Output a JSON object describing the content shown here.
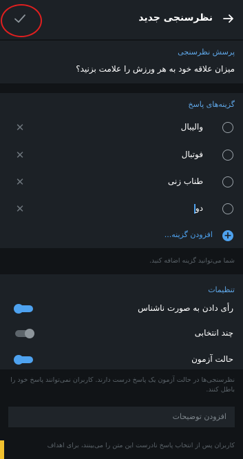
{
  "header": {
    "title": "نظرسنجی جدید",
    "confirm_icon": "check-icon",
    "back_icon": "arrow-right-icon"
  },
  "question": {
    "section_title": "پرسش نظرسنجی",
    "text": "میزان علاقه خود به هر ورزش را علامت بزنید؟"
  },
  "answers": {
    "section_title": "گزینه‌های پاسخ",
    "options": [
      {
        "label": "والیبال"
      },
      {
        "label": "فوتبال"
      },
      {
        "label": "طناب زنی"
      },
      {
        "label": "دو"
      }
    ],
    "add_label": "افزودن گزینه...",
    "hint": "شما می‌توانید گزینه اضافه کنید."
  },
  "settings": {
    "section_title": "تنظیمات",
    "items": [
      {
        "label": "رأی دادن به صورت ناشناس",
        "enabled": true
      },
      {
        "label": "چند انتخابی",
        "enabled": false
      },
      {
        "label": "حالت آزمون",
        "enabled": true
      }
    ],
    "quiz_hint": "نظرسنجی‌ها در حالت آزمون یک پاسخ درست دارند. کاربران نمی‌توانند پاسخ خود را باطل کنند.",
    "explanation_placeholder": "افزودن توضیحات",
    "explanation_hint": "کاربران پس از انتخاب پاسخ نادرست این متن را می‌بینند، برای اهداف"
  },
  "colors": {
    "accent": "#4ea2ef",
    "highlight_circle": "#e01f1f",
    "background": "#111417",
    "section": "#1c2126"
  }
}
